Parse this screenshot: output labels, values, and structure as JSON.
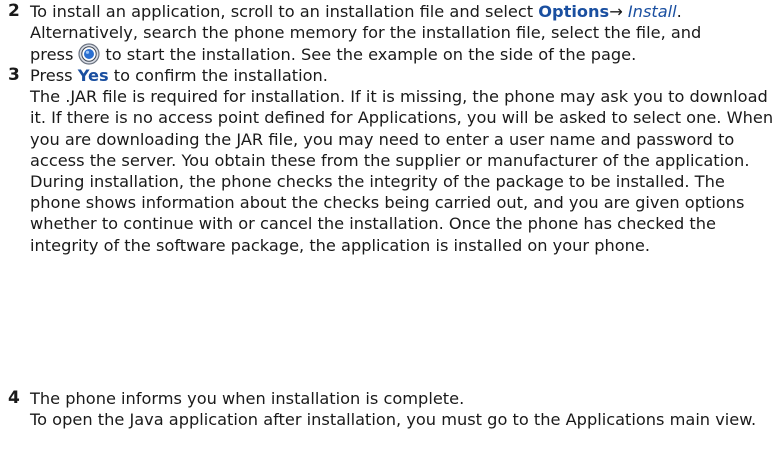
{
  "steps": [
    {
      "number": "2",
      "p1": {
        "lead": "To install an application, scroll to an installation file and select ",
        "menu": "Options",
        "arrow": "→ ",
        "item": "Install",
        "tail": ".",
        "line2": "Alternatively, search the phone memory for the installation file, select the file, and",
        "press": "press",
        "after_icon": "to start the installation. See the example on the side of the page."
      }
    },
    {
      "number": "3",
      "p1": {
        "lead": "Press ",
        "key": "Yes",
        "tail": " to confirm the installation."
      },
      "p2": "The .JAR file is required for installation. If it is missing, the phone may ask you to download it. If there is no access point defined for Applications, you will be asked to select one. When you are downloading the JAR file, you may need to enter a user name and password to access the server. You obtain these from the supplier or manufacturer of the application.",
      "p3": "During installation, the phone checks the integrity of the package to be installed. The phone shows information about the checks being carried out, and you are given options whether to continue with or cancel the installation. Once the phone has checked the integrity of the software package, the application is installed on your phone."
    },
    {
      "number": "4",
      "p1": "The phone informs you when installation is complete.",
      "p2": "To open the Java application after installation, you must go to the Applications main view."
    }
  ],
  "icons": {
    "select_key": "navi-select-key-icon"
  },
  "colors": {
    "keyword": "#1a4fa0",
    "text": "#1a1a1a"
  }
}
